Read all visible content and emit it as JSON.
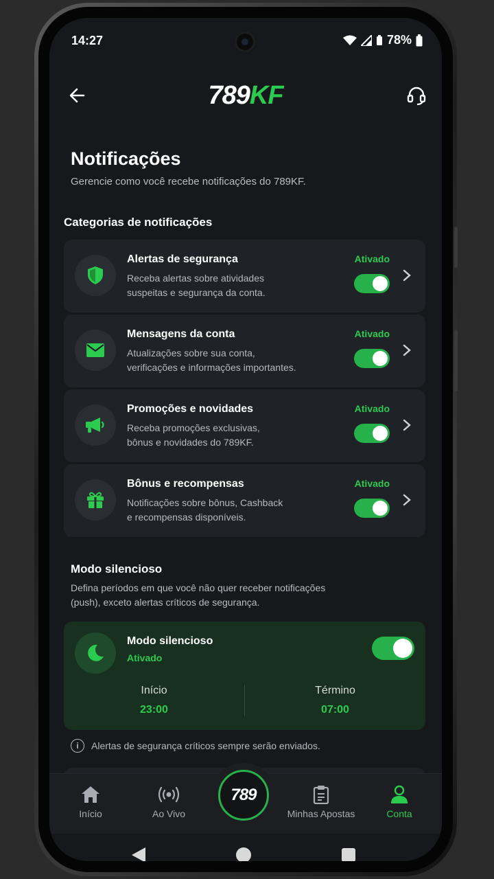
{
  "status_bar": {
    "time": "14:27",
    "battery": "78%"
  },
  "app_bar": {
    "logo_white": "789",
    "logo_green": "KF"
  },
  "page": {
    "title": "Notificações",
    "subtitle": "Gerencie como você recebe notificações do 789KF."
  },
  "categories": {
    "heading": "Categorias de notificações",
    "items": [
      {
        "icon": "shield-icon",
        "title": "Alertas de segurança",
        "desc1": "Receba alertas sobre atividades",
        "desc2": "suspeitas e segurança da conta.",
        "status": "Ativado"
      },
      {
        "icon": "mail-icon",
        "title": "Mensagens da conta",
        "desc1": "Atualizações sobre sua conta,",
        "desc2": "verificações e informações importantes.",
        "status": "Ativado"
      },
      {
        "icon": "megaphone-icon",
        "title": "Promoções e novidades",
        "desc1": "Receba promoções exclusivas,",
        "desc2": "bônus e novidades do 789KF.",
        "status": "Ativado"
      },
      {
        "icon": "gift-icon",
        "title": "Bônus e recompensas",
        "desc1": "Notificações sobre bônus, Cashback",
        "desc2": "e recompensas disponíveis.",
        "status": "Ativado"
      }
    ]
  },
  "silent": {
    "heading": "Modo silencioso",
    "desc1": "Defina períodos em que você não quer receber notificações",
    "desc2": "(push), exceto alertas críticos de segurança.",
    "card_title": "Modo silencioso",
    "card_status": "Ativado",
    "start_label": "Início",
    "start_value": "23:00",
    "end_label": "Término",
    "end_value": "07:00",
    "info": "Alertas de segurança críticos sempre serão enviados."
  },
  "bottom_nav": {
    "items": [
      "Início",
      "Ao Vivo",
      "Minhas Apostas",
      "Conta"
    ],
    "center": "789"
  },
  "colors": {
    "accent": "#2bcb4f",
    "background": "#16181b",
    "card": "#1f2226"
  }
}
